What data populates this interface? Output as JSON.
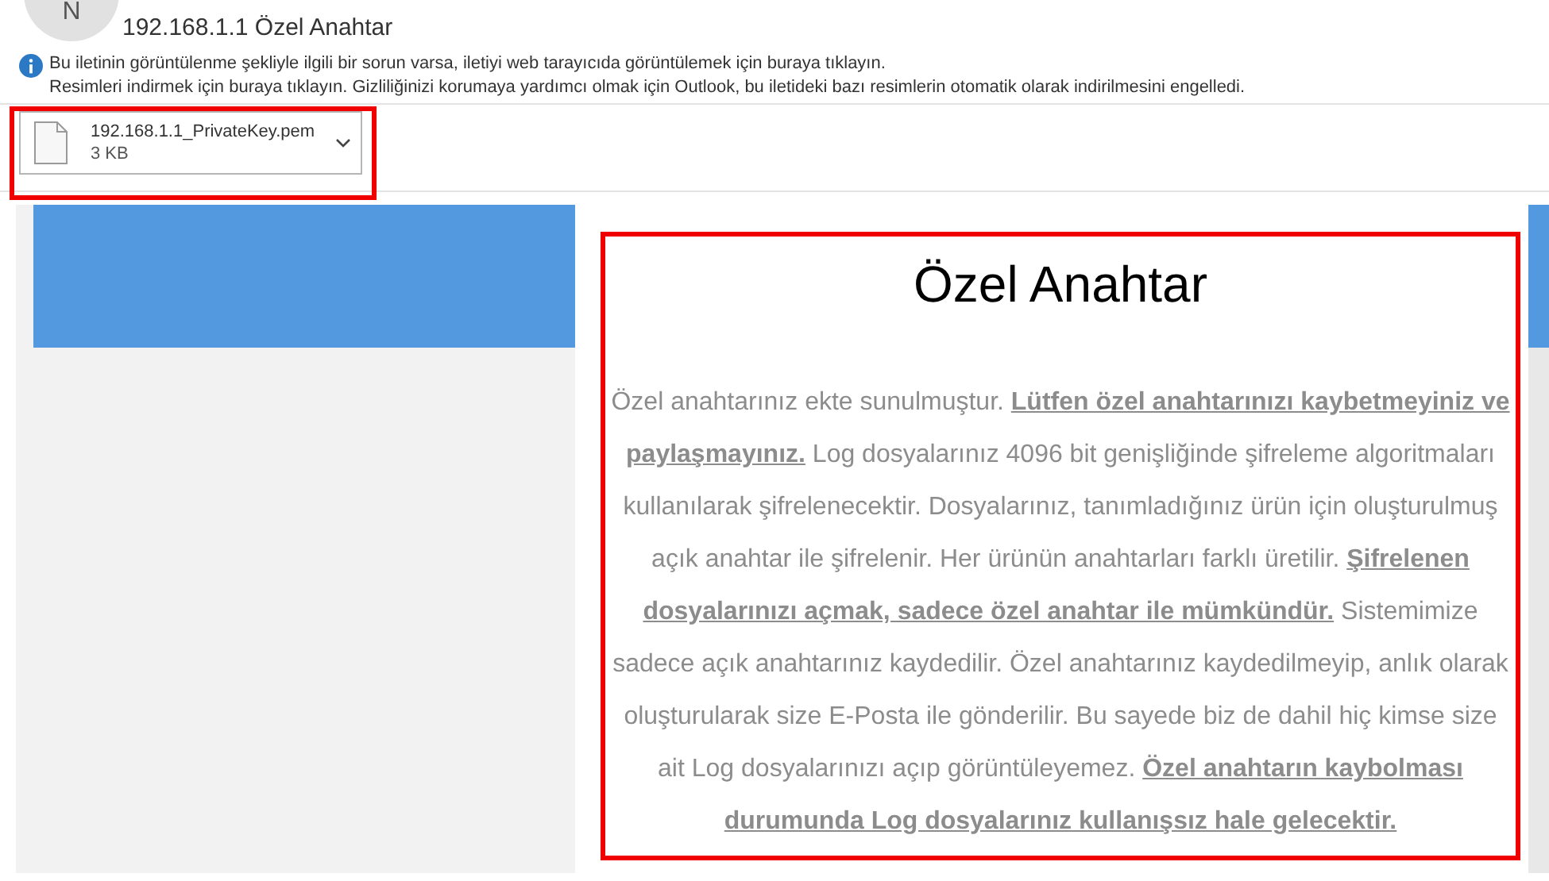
{
  "sender_avatar": {
    "initial": "N"
  },
  "subject": "192.168.1.1 Özel Anahtar",
  "info_lines": [
    "Bu iletinin görüntülenme şekliyle ilgili bir sorun varsa, iletiyi web tarayıcıda görüntülemek için buraya tıklayın.",
    "Resimleri indirmek için buraya tıklayın. Gizliliğinizi korumaya yardımcı olmak için Outlook, bu iletideki bazı resimlerin otomatik olarak indirilmesini engelledi."
  ],
  "attachment": {
    "name": "192.168.1.1_PrivateKey.pem",
    "size": "3 KB"
  },
  "message": {
    "heading": "Özel Anahtar",
    "paragraph": "Özel anahtarınız ekte sunulmuştur. **Lütfen özel anahtarınızı kaybetmeyiniz ve paylaşmayınız.** Log dosyalarınız 4096 bit genişliğinde şifreleme algoritmaları kullanılarak şifrelenecektir. Dosyalarınız, tanımladığınız ürün için oluşturulmuş açık anahtar ile şifrelenir. Her ürünün anahtarları farklı üretilir. **Şifrelenen dosyalarınızı açmak, sadece özel anahtar ile mümkündür.** Sistemimize sadece açık anahtarınız kaydedilir. Özel anahtarınız kaydedilmeyip, anlık olarak oluşturularak size E-Posta ile gönderilir. Bu sayede biz de dahil hiç kimse size ait Log dosyalarınızı açıp görüntüleyemez. **Özel anahtarın kaybolması durumunda Log dosyalarınız kullanışsız hale gelecektir.**"
  }
}
